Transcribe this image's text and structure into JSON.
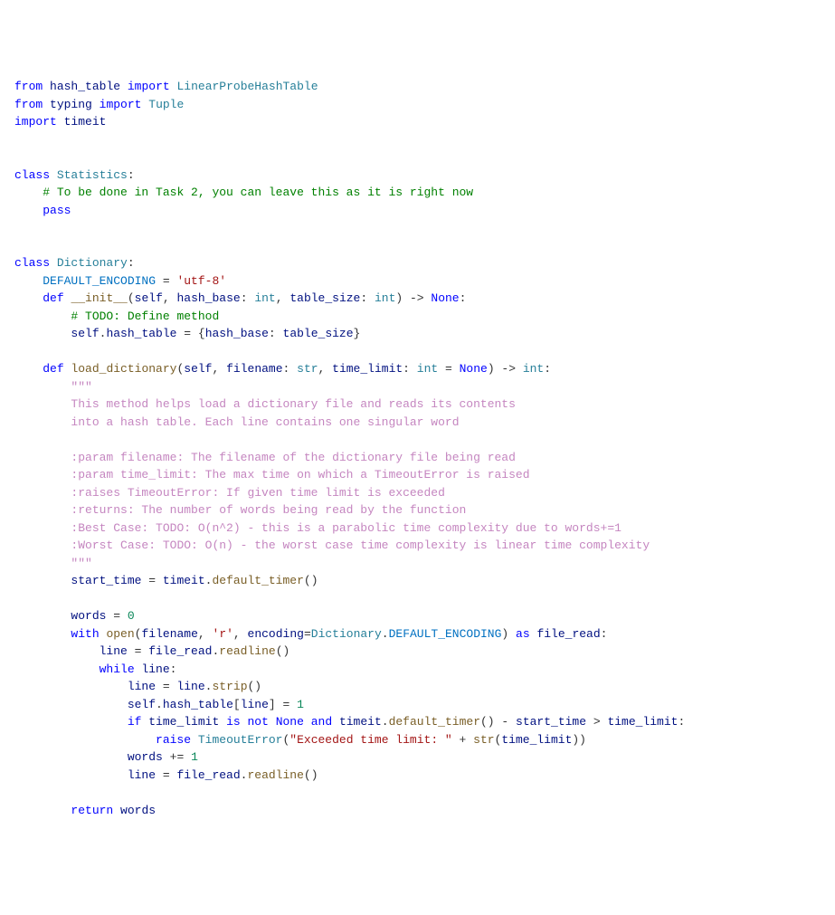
{
  "code": {
    "l1": {
      "kw1": "from",
      "mod1": "hash_table",
      "kw2": "import",
      "cls1": "LinearProbeHashTable"
    },
    "l2": {
      "kw1": "from",
      "mod1": "typing",
      "kw2": "import",
      "cls1": "Tuple"
    },
    "l3": {
      "kw1": "import",
      "mod1": "timeit"
    },
    "l4": {
      "kw1": "class",
      "cls1": "Statistics",
      "colon": ":"
    },
    "l5": {
      "com": "# To be done in Task 2, you can leave this as it is right now"
    },
    "l6": {
      "kw1": "pass"
    },
    "l7": {
      "kw1": "class",
      "cls1": "Dictionary",
      "colon": ":"
    },
    "l8": {
      "const": "DEFAULT_ENCODING",
      "eq": " = ",
      "str": "'utf-8'"
    },
    "l9": {
      "kw1": "def",
      "func": "__init__",
      "p1": "(",
      "self": "self",
      "c1": ", ",
      "p2": "hash_base",
      "c2": ": ",
      "t1": "int",
      "c3": ", ",
      "p3": "table_size",
      "c4": ": ",
      "t2": "int",
      "p4": ") -> ",
      "ret": "None",
      "colon": ":"
    },
    "l10": {
      "com": "# TODO: Define method"
    },
    "l11": {
      "self": "self",
      "dot": ".",
      "attr": "hash_table",
      "eq": " = {",
      "p1": "hash_base",
      "c1": ": ",
      "p2": "table_size",
      "close": "}"
    },
    "l12": {
      "kw1": "def",
      "func": "load_dictionary",
      "p1": "(",
      "self": "self",
      "c1": ", ",
      "p2": "filename",
      "c2": ": ",
      "t1": "str",
      "c3": ", ",
      "p3": "time_limit",
      "c4": ": ",
      "t2": "int",
      "eq": " = ",
      "none": "None",
      "p4": ") -> ",
      "ret": "int",
      "colon": ":"
    },
    "l13": {
      "doc": "\"\"\""
    },
    "l14": {
      "doc": "This method helps load a dictionary file and reads its contents"
    },
    "l15": {
      "doc": "into a hash table. Each line contains one singular word"
    },
    "l16": {
      "doc": ":param filename: The filename of the dictionary file being read"
    },
    "l17": {
      "doc": ":param time_limit: The max time on which a TimeoutError is raised"
    },
    "l18": {
      "doc": ":raises TimeoutError: If given time limit is exceeded"
    },
    "l19": {
      "doc": ":returns: The number of words being read by the function"
    },
    "l20": {
      "doc": ":Best Case: TODO: O(n^2) - this is a parabolic time complexity due to words+=1"
    },
    "l21": {
      "doc": ":Worst Case: TODO: O(n) - the worst case time complexity is linear time complexity"
    },
    "l22": {
      "doc": "\"\"\""
    },
    "l23": {
      "var": "start_time",
      "eq": " = ",
      "mod": "timeit",
      "dot": ".",
      "func": "default_timer",
      "paren": "()"
    },
    "l24": {
      "var": "words",
      "eq": " = ",
      "num": "0"
    },
    "l25": {
      "kw1": "with",
      "sp1": " ",
      "func": "open",
      "p1": "(",
      "v1": "filename",
      "c1": ", ",
      "str1": "'r'",
      "c2": ", ",
      "kw2": "encoding",
      "eq": "=",
      "cls": "Dictionary",
      "dot": ".",
      "const": "DEFAULT_ENCODING",
      "p2": ") ",
      "kw3": "as",
      "sp2": " ",
      "v2": "file_read",
      "colon": ":"
    },
    "l26": {
      "var": "line",
      "eq": " = ",
      "obj": "file_read",
      "dot": ".",
      "func": "readline",
      "paren": "()"
    },
    "l27": {
      "kw1": "while",
      "sp": " ",
      "var": "line",
      "colon": ":"
    },
    "l28": {
      "var": "line",
      "eq": " = ",
      "obj": "line",
      "dot": ".",
      "func": "strip",
      "paren": "()"
    },
    "l29": {
      "self": "self",
      "dot1": ".",
      "attr": "hash_table",
      "br1": "[",
      "var": "line",
      "br2": "] = ",
      "num": "1"
    },
    "l30": {
      "kw1": "if",
      "sp1": " ",
      "v1": "time_limit",
      "sp2": " ",
      "kw2": "is not",
      "sp3": " ",
      "none": "None",
      "sp4": " ",
      "kw3": "and",
      "sp5": " ",
      "mod": "timeit",
      "dot": ".",
      "func": "default_timer",
      "paren": "()",
      "sp6": " - ",
      "v2": "start_time",
      "sp7": " > ",
      "v3": "time_limit",
      "colon": ":"
    },
    "l31": {
      "kw1": "raise",
      "sp": " ",
      "cls": "TimeoutError",
      "p1": "(",
      "str": "\"Exceeded time limit: \"",
      "sp2": " + ",
      "func": "str",
      "p2": "(",
      "var": "time_limit",
      "p3": "))"
    },
    "l32": {
      "var": "words",
      "op": " += ",
      "num": "1"
    },
    "l33": {
      "var": "line",
      "eq": " = ",
      "obj": "file_read",
      "dot": ".",
      "func": "readline",
      "paren": "()"
    },
    "l34": {
      "kw1": "return",
      "sp": " ",
      "var": "words"
    }
  }
}
